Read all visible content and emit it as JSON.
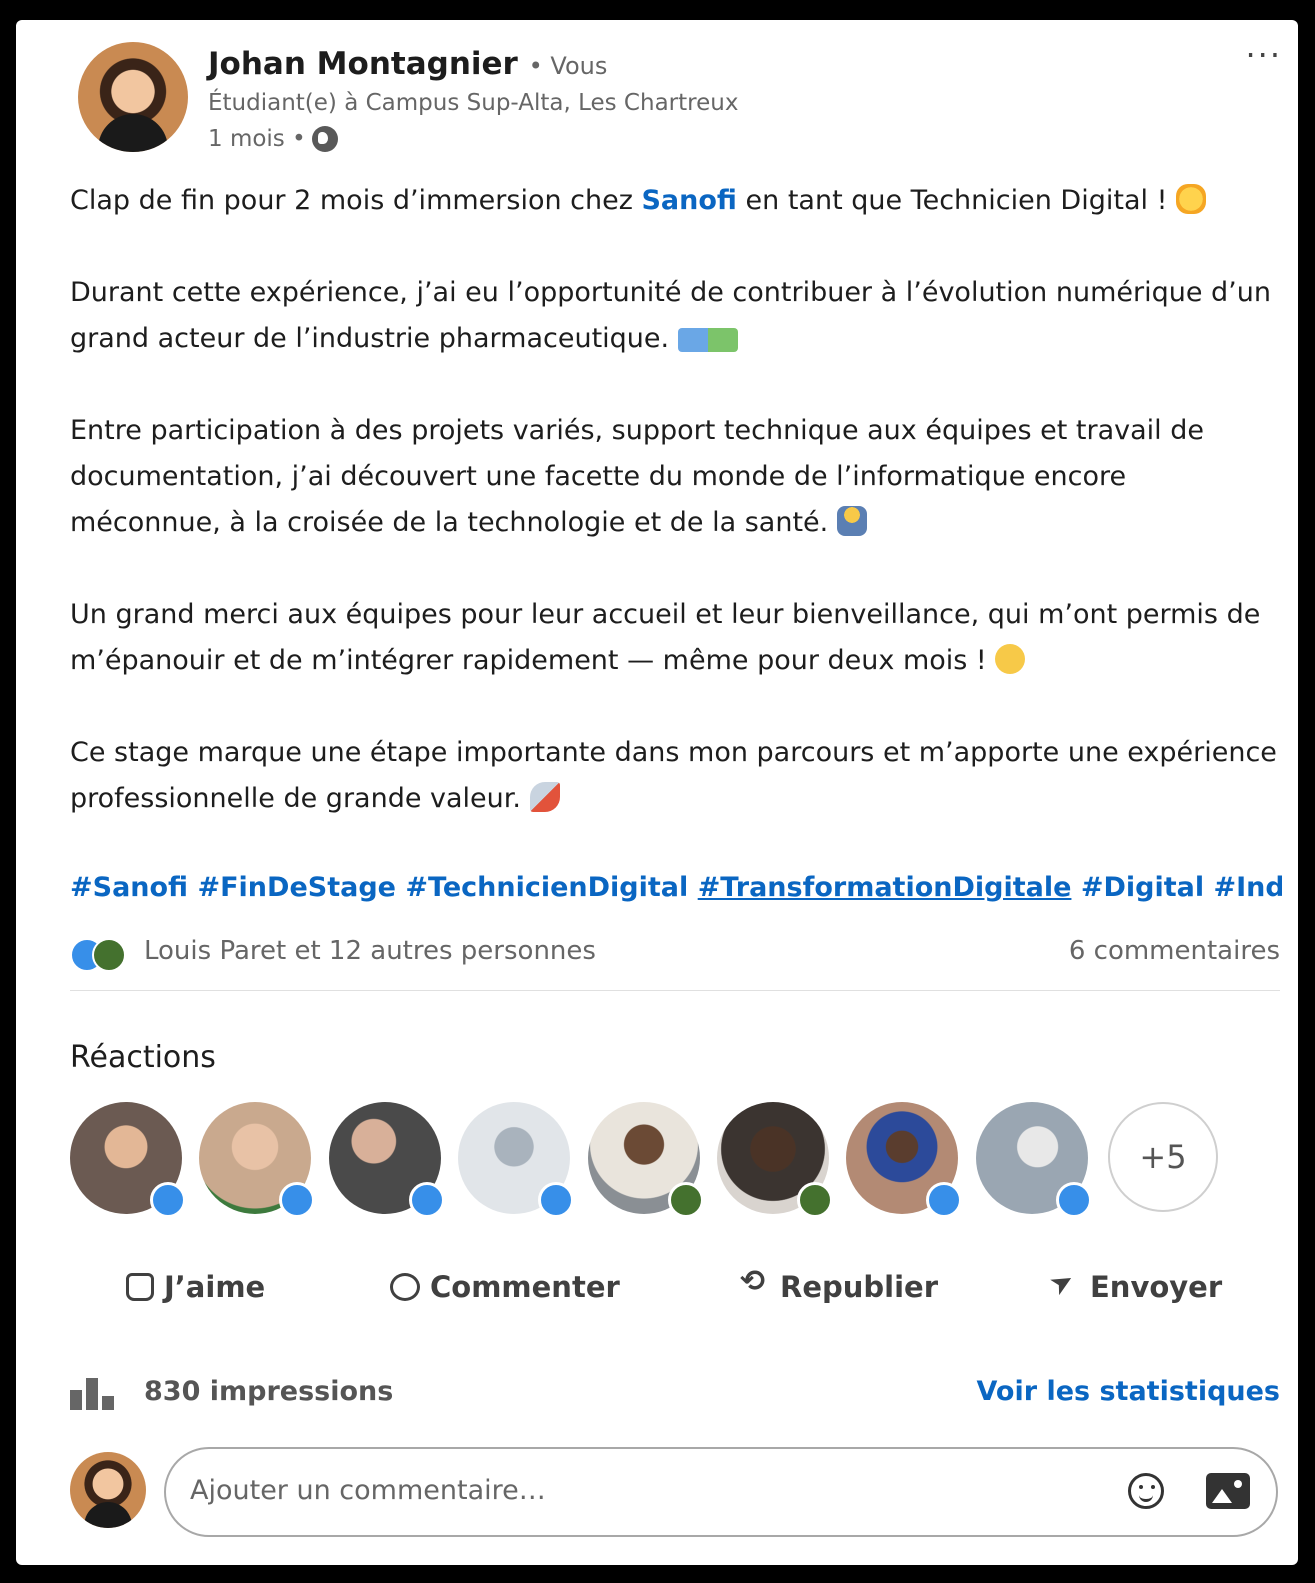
{
  "post": {
    "author": "Johan Montagnier",
    "you_label": "• Vous",
    "headline": "Étudiant(e) à Campus Sup-Alta, Les Chartreux",
    "age": "1 mois •",
    "visibility_icon": "globe-icon",
    "paragraphs": [
      {
        "before": "Clap de fin pour 2 mois d’immersion chez ",
        "link": "Sanofi",
        "after": " en tant que Technicien Digital !",
        "emoji": "clap"
      },
      {
        "text": "Durant cette expérience, j’ai eu l’opportunité de contribuer à l’évolution numérique d’un grand acteur de l’industrie pharmaceutique.",
        "emoji": "laptop-testtube"
      },
      {
        "text": "Entre participation à des projets variés, support technique aux équipes et travail de documentation, j’ai découvert une facette du monde de l’informatique encore méconnue, à la croisée de la technologie et de la santé.",
        "emoji": "technologist"
      },
      {
        "text": "Un grand merci aux équipes pour leur accueil et leur bienveillance, qui m’ont permis de m’épanouir et de m’intégrer rapidement — même pour deux mois !",
        "emoji": "grin"
      },
      {
        "text": "Ce stage marque une étape importante dans mon parcours et m’apporte une expérience professionnelle de grande valeur.",
        "emoji": "rocket"
      }
    ],
    "hashtags": [
      "#Sanofi",
      "#FinDeStage",
      "#TechnicienDigital",
      "#TransformationDigitale",
      "#Digital",
      "#Indu"
    ],
    "reactions_summary": "Louis Paret et 12 autres personnes",
    "comments_count": "6 commentaires"
  },
  "reactions": {
    "title": "Réactions",
    "people": [
      {
        "badge": "like",
        "color": "#6b5a52"
      },
      {
        "badge": "like",
        "color": "#c9a98e"
      },
      {
        "badge": "like",
        "color": "#4a4a4a"
      },
      {
        "badge": "like",
        "color": "#cfd4da"
      },
      {
        "badge": "clap",
        "color": "#8a8f94"
      },
      {
        "badge": "clap",
        "color": "#3b3430"
      },
      {
        "badge": "like",
        "color": "#b38a74"
      },
      {
        "badge": "like",
        "color": "#9aa6b2"
      }
    ],
    "more": "+5"
  },
  "actions": {
    "like": "J’aime",
    "comment": "Commenter",
    "repost": "Republier",
    "send": "Envoyer"
  },
  "stats": {
    "impressions": "830 impressions",
    "see_stats": "Voir les statistiques"
  },
  "comment_box": {
    "placeholder": "Ajouter un commentaire…"
  },
  "colors": {
    "link": "#0a66c2",
    "like_badge": "#378fe9",
    "clap_badge": "#44712e"
  }
}
